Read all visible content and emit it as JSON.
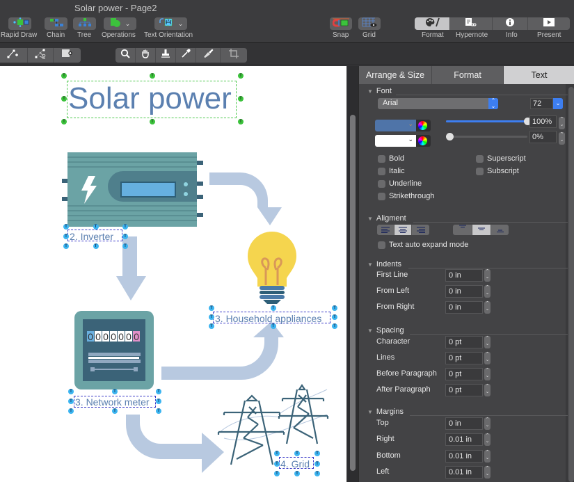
{
  "window": {
    "title": "Solar power - Page2"
  },
  "toolbar": {
    "tools": [
      {
        "id": "rapid-draw",
        "label": "Rapid Draw",
        "icon": "rapid-draw-icon"
      },
      {
        "id": "chain",
        "label": "Chain",
        "icon": "chain-icon"
      },
      {
        "id": "tree",
        "label": "Tree",
        "icon": "tree-icon"
      },
      {
        "id": "operations",
        "label": "Operations",
        "icon": "operations-icon",
        "has_dropdown": true
      },
      {
        "id": "text-orientation",
        "label": "Text Orientation",
        "icon": "text-orientation-icon",
        "has_dropdown": true
      }
    ],
    "view_tools": [
      {
        "id": "snap",
        "label": "Snap",
        "icon": "snap-icon"
      },
      {
        "id": "grid",
        "label": "Grid",
        "icon": "grid-icon"
      }
    ],
    "panels": [
      {
        "id": "format",
        "label": "Format",
        "icon": "palette-icon",
        "active": true
      },
      {
        "id": "hypernote",
        "label": "Hypernote",
        "icon": "hypernote-icon",
        "active": false
      },
      {
        "id": "info",
        "label": "Info",
        "icon": "info-icon",
        "active": false
      },
      {
        "id": "present",
        "label": "Present",
        "icon": "present-icon",
        "active": false
      }
    ]
  },
  "toolbar2": {
    "edit_tools": [
      "add-point-icon",
      "cut-point-icon",
      "connection-point-icon"
    ],
    "canvas_tools": [
      "zoom-icon",
      "hand-icon",
      "stamp-icon",
      "eyedropper-icon",
      "brush-icon",
      "crop-icon"
    ],
    "zoom_slider": {
      "value_fraction": 0.16
    }
  },
  "diagram": {
    "title": "Solar power",
    "labels": {
      "inverter": "2. Inverter",
      "household": "3. Household appliances",
      "meter": "3. Network meter",
      "grid": "4. Grid"
    },
    "meter_digits": [
      "0",
      "0",
      "0",
      "0",
      "0",
      "0",
      "0"
    ],
    "colors": {
      "text": "#5b80b0",
      "arrow": "#b8c9e0",
      "device_teal": "#6ba3a5",
      "device_dark": "#3b6378",
      "bulb": "#f5d54e",
      "handle_green": "#3cc23c",
      "handle_blue": "#3bb4f0"
    }
  },
  "panel": {
    "tabs": [
      {
        "label": "Arrange & Size",
        "active": false
      },
      {
        "label": "Format",
        "active": false
      },
      {
        "label": "Text",
        "active": true
      }
    ],
    "font": {
      "section": "Font",
      "family": "Arial",
      "size": "72",
      "text_color": "#4f74a8",
      "bg_color": "#ffffff",
      "opacity": "100%",
      "opacity_value": 1.0,
      "bg_opacity": "0%",
      "bg_opacity_value": 0.0,
      "styles_left": [
        "Bold",
        "Italic",
        "Underline",
        "Strikethrough"
      ],
      "styles_right": [
        "Superscript",
        "Subscript"
      ]
    },
    "alignment": {
      "section": "Aligment",
      "horizontal_selected": "center",
      "vertical_selected": "middle",
      "auto_expand": "Text auto expand mode"
    },
    "indents": {
      "section": "Indents",
      "rows": [
        {
          "label": "First Line",
          "value": "0 in"
        },
        {
          "label": "From Left",
          "value": "0 in"
        },
        {
          "label": "From Right",
          "value": "0 in"
        }
      ]
    },
    "spacing": {
      "section": "Spacing",
      "rows": [
        {
          "label": "Character",
          "value": "0 pt"
        },
        {
          "label": "Lines",
          "value": "0 pt"
        },
        {
          "label": "Before Paragraph",
          "value": "0 pt"
        },
        {
          "label": "After Paragraph",
          "value": "0 pt"
        }
      ]
    },
    "margins": {
      "section": "Margins",
      "rows": [
        {
          "label": "Top",
          "value": "0 in"
        },
        {
          "label": "Right",
          "value": "0.01 in"
        },
        {
          "label": "Bottom",
          "value": "0.01 in"
        },
        {
          "label": "Left",
          "value": "0.01 in"
        }
      ]
    }
  }
}
